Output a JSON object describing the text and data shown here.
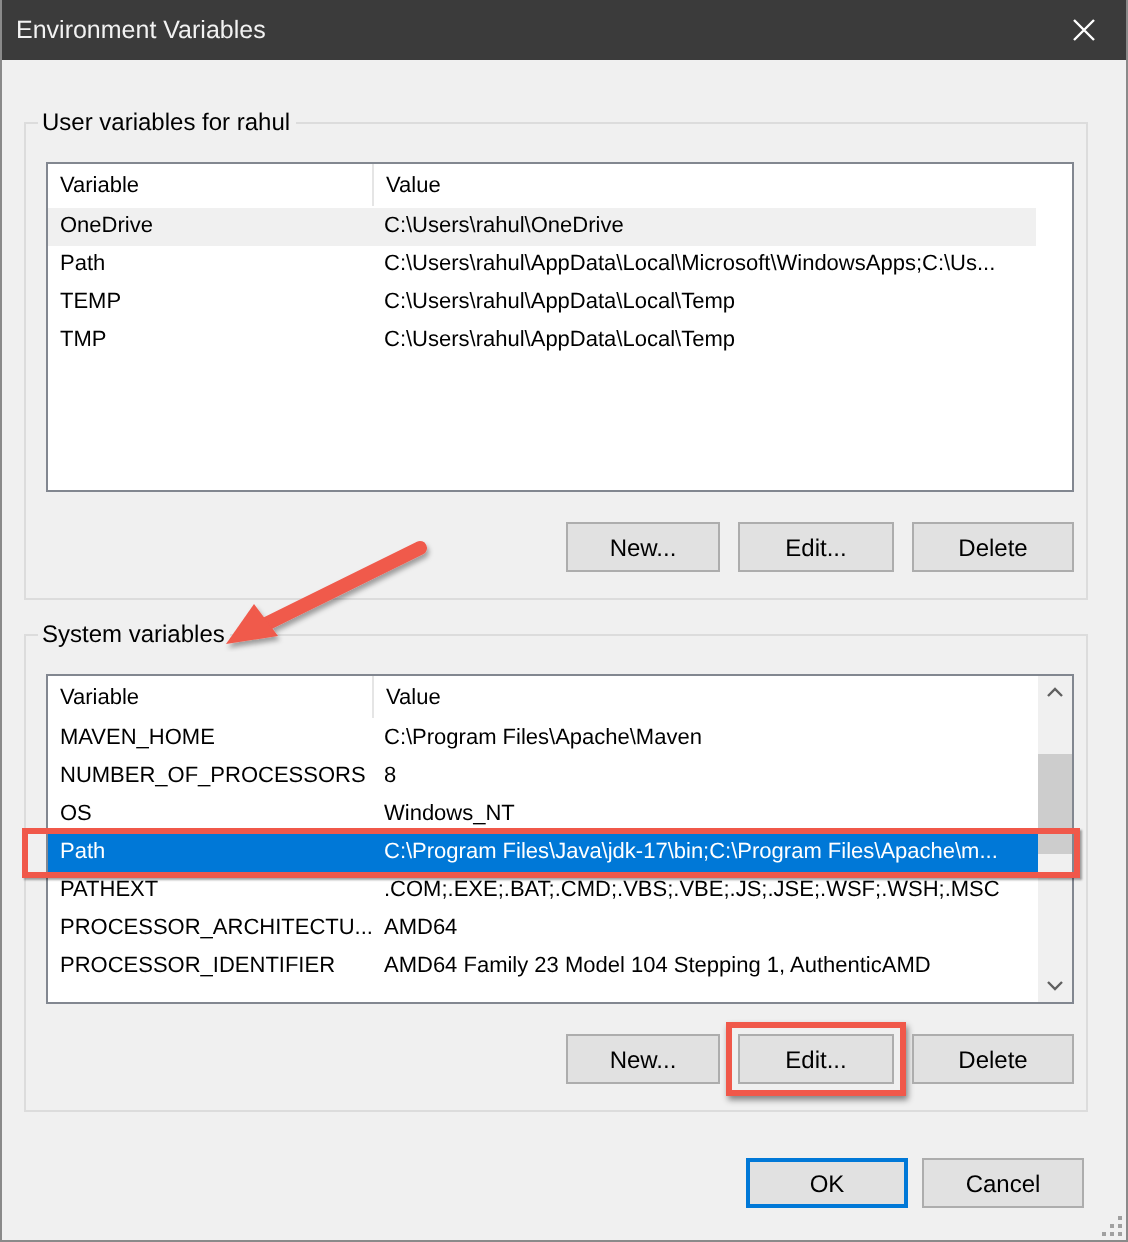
{
  "window": {
    "title": "Environment Variables"
  },
  "groups": [
    {
      "title": "User variables for rahul",
      "focused": false,
      "arrow": false,
      "columns": [
        "Variable",
        "Value"
      ],
      "scrollbar": false,
      "rows": [
        {
          "variable": "OneDrive",
          "value": "C:\\Users\\rahul\\OneDrive",
          "selected": true,
          "highlighted": false
        },
        {
          "variable": "Path",
          "value": "C:\\Users\\rahul\\AppData\\Local\\Microsoft\\WindowsApps;C:\\Us...",
          "selected": false,
          "highlighted": false
        },
        {
          "variable": "TEMP",
          "value": "C:\\Users\\rahul\\AppData\\Local\\Temp",
          "selected": false,
          "highlighted": false
        },
        {
          "variable": "TMP",
          "value": "C:\\Users\\rahul\\AppData\\Local\\Temp",
          "selected": false,
          "highlighted": false
        }
      ],
      "buttons": [
        {
          "label": "New...",
          "highlighted": false
        },
        {
          "label": "Edit...",
          "highlighted": false
        },
        {
          "label": "Delete",
          "highlighted": false
        }
      ]
    },
    {
      "title": "System variables",
      "focused": true,
      "arrow": true,
      "columns": [
        "Variable",
        "Value"
      ],
      "scrollbar": true,
      "rows": [
        {
          "variable": "MAVEN_HOME",
          "value": "C:\\Program Files\\Apache\\Maven",
          "selected": false,
          "highlighted": false
        },
        {
          "variable": "NUMBER_OF_PROCESSORS",
          "value": "8",
          "selected": false,
          "highlighted": false
        },
        {
          "variable": "OS",
          "value": "Windows_NT",
          "selected": false,
          "highlighted": false
        },
        {
          "variable": "Path",
          "value": "C:\\Program Files\\Java\\jdk-17\\bin;C:\\Program Files\\Apache\\m...",
          "selected": true,
          "highlighted": true
        },
        {
          "variable": "PATHEXT",
          "value": ".COM;.EXE;.BAT;.CMD;.VBS;.VBE;.JS;.JSE;.WSF;.WSH;.MSC",
          "selected": false,
          "highlighted": false
        },
        {
          "variable": "PROCESSOR_ARCHITECTU...",
          "value": "AMD64",
          "selected": false,
          "highlighted": false
        },
        {
          "variable": "PROCESSOR_IDENTIFIER",
          "value": "AMD64 Family 23 Model 104 Stepping 1, AuthenticAMD",
          "selected": false,
          "highlighted": false
        }
      ],
      "buttons": [
        {
          "label": "New...",
          "highlighted": false
        },
        {
          "label": "Edit...",
          "highlighted": true
        },
        {
          "label": "Delete",
          "highlighted": false
        }
      ]
    }
  ],
  "buttons": [
    {
      "label": "OK",
      "default": true
    },
    {
      "label": "Cancel",
      "default": false
    }
  ]
}
